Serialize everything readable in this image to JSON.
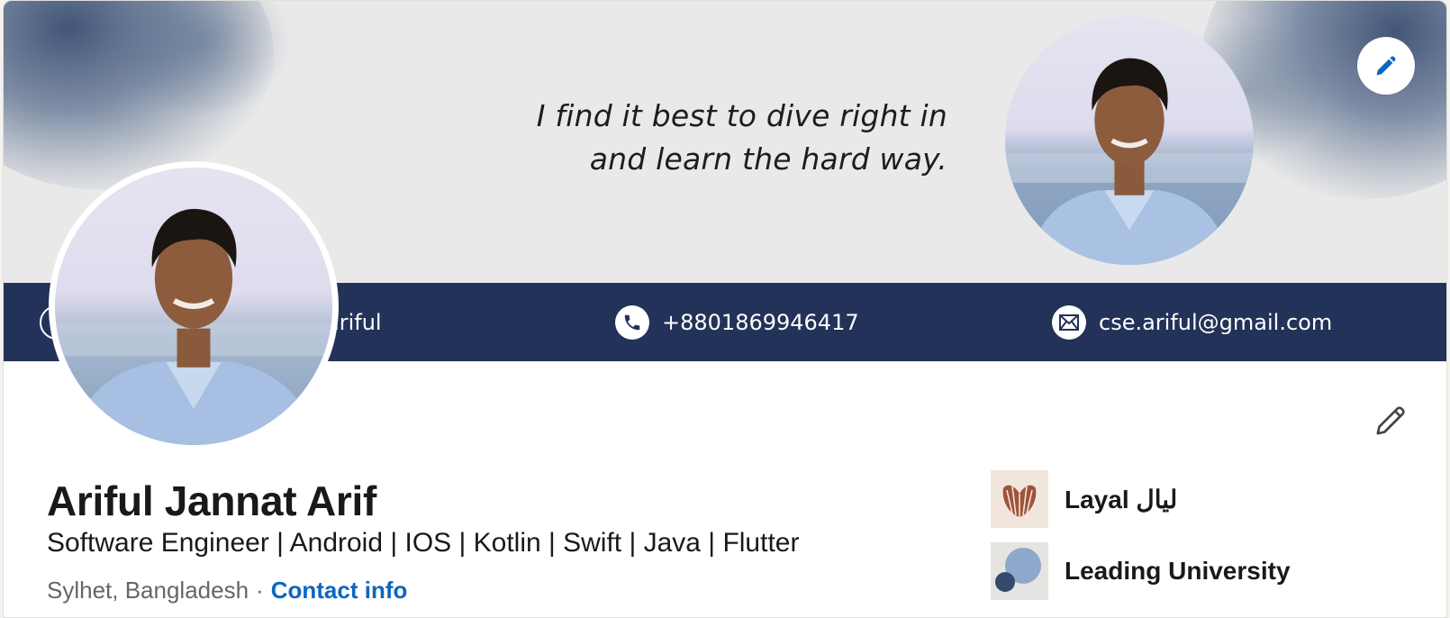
{
  "banner": {
    "quote_line1": "I find it best to dive right in",
    "quote_line2": "and learn the hard way.",
    "website_fragment": "ariful",
    "phone": "+8801869946417",
    "email": "cse.ariful@gmail.com",
    "icons": [
      "globe-icon",
      "phone-icon",
      "mail-icon"
    ]
  },
  "profile": {
    "name": "Ariful Jannat Arif",
    "headline": "Software Engineer | Android | IOS | Kotlin | Swift | Java | Flutter",
    "location": "Sylhet, Bangladesh",
    "separator": "·",
    "contact_info_label": "Contact info"
  },
  "organizations": [
    {
      "name": "Layal ليال",
      "logo": "shell-logo"
    },
    {
      "name": "Leading University",
      "logo": "circles-logo"
    }
  ],
  "colors": {
    "banner_bar": "#233258",
    "link": "#0a66c2",
    "edit_icon_blue": "#0a66c2",
    "text": "#191919"
  }
}
